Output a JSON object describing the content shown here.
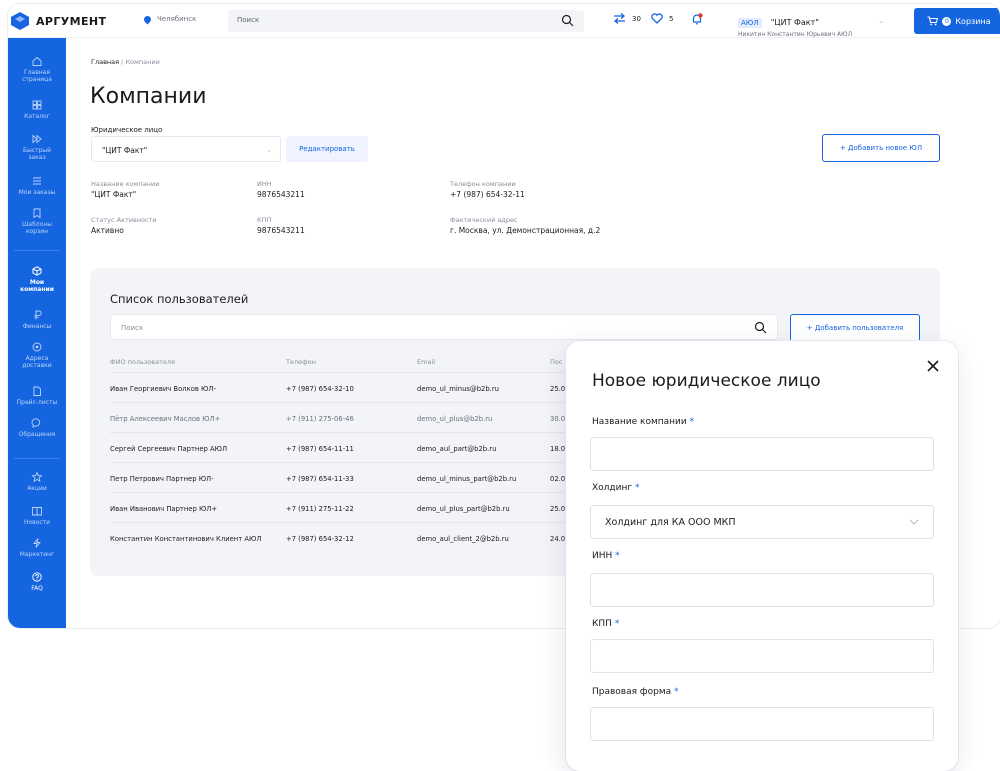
{
  "header": {
    "logo_text": "АРГУМЕНТ",
    "city": "Челябинск",
    "search_placeholder": "Поиск",
    "compare_count": "30",
    "favorites_count": "5",
    "role_badge": "АЮЛ",
    "company": "\"ЦИТ Факт\"",
    "user_name": "Никитин Константин Юрьевич АЮЛ",
    "cart_count": "0",
    "cart_label": "Корзина"
  },
  "sidebar": {
    "items": [
      {
        "label1": "Главная",
        "label2": "страница",
        "icon": "home-icon"
      },
      {
        "label1": "Каталог",
        "label2": "",
        "icon": "catalog-icon"
      },
      {
        "label1": "Быстрый",
        "label2": "заказ",
        "icon": "fast-order-icon"
      },
      {
        "label1": "Мои заказы",
        "label2": "",
        "icon": "orders-icon"
      },
      {
        "label1": "Шаблоны",
        "label2": "корзин",
        "icon": "cart-templates-icon"
      },
      {
        "label1": "Мои",
        "label2": "компании",
        "icon": "companies-icon"
      },
      {
        "label1": "Финансы",
        "label2": "",
        "icon": "finance-icon"
      },
      {
        "label1": "Адреса",
        "label2": "доставки",
        "icon": "addresses-icon"
      },
      {
        "label1": "Прайс-листы",
        "label2": "",
        "icon": "price-lists-icon"
      },
      {
        "label1": "Обращения",
        "label2": "",
        "icon": "requests-icon"
      },
      {
        "label1": "Акции",
        "label2": "",
        "icon": "promotions-icon"
      },
      {
        "label1": "Новости",
        "label2": "",
        "icon": "news-icon"
      },
      {
        "label1": "Маркетинг",
        "label2": "",
        "icon": "marketing-icon"
      },
      {
        "label1": "FAQ",
        "label2": "",
        "icon": "faq-icon"
      }
    ]
  },
  "breadcrumb": {
    "home": "Главная",
    "sep": "/",
    "current": "Компании"
  },
  "page": {
    "title": "Компании",
    "legal_entity_label": "Юридическое лицо",
    "legal_entity_value": "\"ЦИТ Факт\"",
    "edit_label": "Редактировать",
    "add_entity_label": "+ Добавить новое ЮЛ"
  },
  "company_info": {
    "name_label": "Название компании",
    "name_value": "\"ЦИТ Факт\"",
    "inn_label": "ИНН",
    "inn_value": "9876543211",
    "phone_label": "Телефон компании",
    "phone_value": "+7 (987) 654-32-11",
    "status_label": "Статус Активности",
    "status_value": "Активно",
    "kpp_label": "КПП",
    "kpp_value": "9876543211",
    "address_label": "Фактический адрес",
    "address_value": "г. Москва, ул. Демонстрационная, д.2"
  },
  "users": {
    "title": "Список пользователей",
    "search_placeholder": "Поиск",
    "add_label": "+ Добавить пользователя",
    "columns": [
      "ФИО пользователя",
      "Телефон",
      "Email",
      "Пос"
    ],
    "rows": [
      {
        "name": "Иван Георгиевич Волков ЮЛ-",
        "phone": "+7 (987) 654-32-10",
        "email": "demo_ul_minus@b2b.ru",
        "date": "25.0"
      },
      {
        "name": "Пётр Алексеевич Маслов ЮЛ+",
        "phone": "+7 (911) 275-06-46",
        "email": "demo_ul_plus@b2b.ru",
        "date": "30.0"
      },
      {
        "name": "Сергей Сергеевич Партнер АЮЛ",
        "phone": "+7 (987) 654-11-11",
        "email": "demo_aul_part@b2b.ru",
        "date": "18.0"
      },
      {
        "name": "Петр Петрович Партнер ЮЛ-",
        "phone": "+7 (987) 654-11-33",
        "email": "demo_ul_minus_part@b2b.ru",
        "date": "02.0"
      },
      {
        "name": "Иван Иванович Партнер ЮЛ+",
        "phone": "+7 (911) 275-11-22",
        "email": "demo_ul_plus_part@b2b.ru",
        "date": "25.0"
      },
      {
        "name": "Константин Константинович Клиент АЮЛ",
        "phone": "+7 (987) 654-32-12",
        "email": "demo_aul_client_2@b2b.ru",
        "date": "24.0"
      }
    ]
  },
  "modal": {
    "title": "Новое юридическое лицо",
    "required_mark": "*",
    "company_name_label": "Название компании",
    "holding_label": "Холдинг",
    "holding_value": "Холдинг для КА ООО МКП",
    "inn_label": "ИНН",
    "kpp_label": "КПП",
    "legal_form_label": "Правовая форма"
  },
  "colors": {
    "accent": "#1565e0",
    "sidebar": "#1565e0",
    "card_bg": "#f3f4f7"
  }
}
